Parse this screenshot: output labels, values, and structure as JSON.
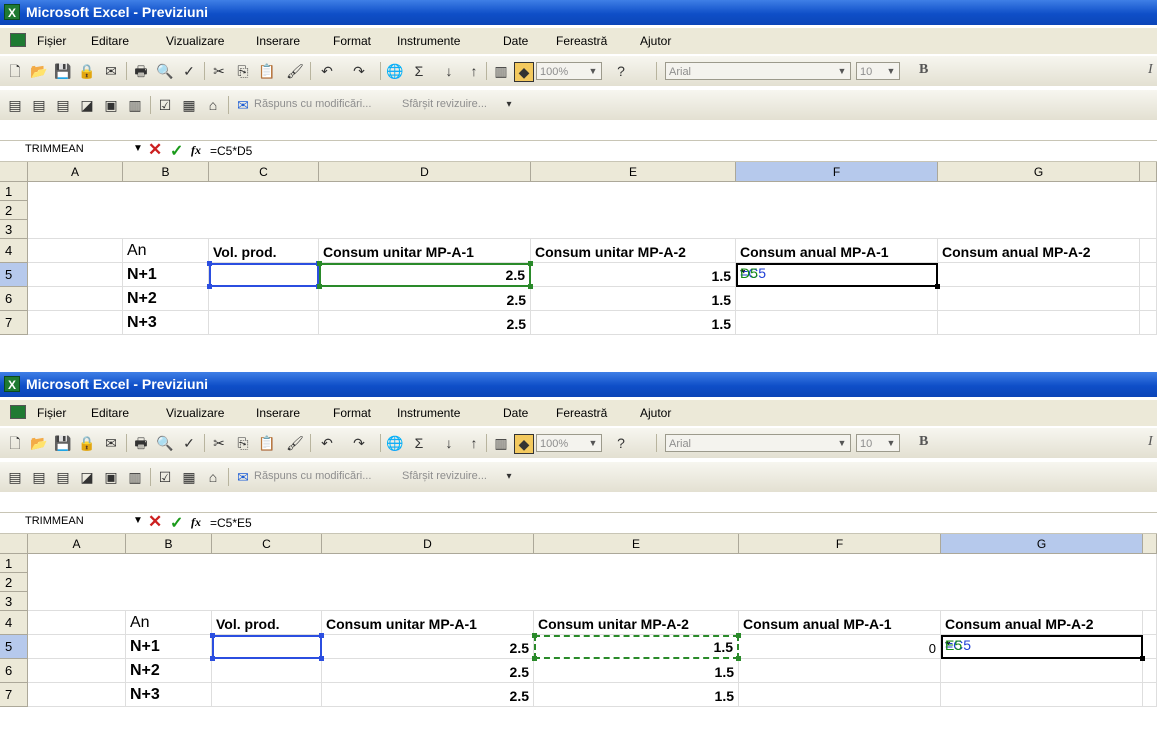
{
  "windows": [
    {
      "title": "Microsoft Excel - Previziuni",
      "menu": [
        "Fișier",
        "Editare",
        "Vizualizare",
        "Inserare",
        "Format",
        "Instrumente",
        "Date",
        "Fereastră",
        "Ajutor"
      ],
      "toolbar": {
        "zoom": "100%",
        "font": "Arial",
        "size": "10",
        "bold": "B",
        "italic": "I",
        "review_reply": "Răspuns cu modificări...",
        "review_end": "Sfârșit revizuire..."
      },
      "formula_bar": {
        "name_box": "TRIMMEAN",
        "formula": "=C5*D5"
      },
      "columns": [
        "A",
        "B",
        "C",
        "D",
        "E",
        "F",
        "G"
      ],
      "rows": [
        "1",
        "2",
        "3",
        "4",
        "5",
        "6",
        "7"
      ],
      "header_row": {
        "b": "An",
        "c": "Vol. prod.",
        "d": "Consum unitar MP-A-1",
        "e": "Consum unitar MP-A-2",
        "f": "Consum anual MP-A-1",
        "g": "Consum anual MP-A-2"
      },
      "data": [
        {
          "b": "N+1",
          "d": "2.5",
          "e": "1.5"
        },
        {
          "b": "N+2",
          "d": "2.5",
          "e": "1.5"
        },
        {
          "b": "N+3",
          "d": "2.5",
          "e": "1.5"
        }
      ],
      "edit_cell": {
        "part1": "=C5",
        "op": "*",
        "part2": "D5"
      }
    },
    {
      "title": "Microsoft Excel - Previziuni",
      "menu": [
        "Fișier",
        "Editare",
        "Vizualizare",
        "Inserare",
        "Format",
        "Instrumente",
        "Date",
        "Fereastră",
        "Ajutor"
      ],
      "toolbar": {
        "zoom": "100%",
        "font": "Arial",
        "size": "10",
        "bold": "B",
        "italic": "I",
        "review_reply": "Răspuns cu modificări...",
        "review_end": "Sfârșit revizuire..."
      },
      "formula_bar": {
        "name_box": "TRIMMEAN",
        "formula": "=C5*E5"
      },
      "columns": [
        "A",
        "B",
        "C",
        "D",
        "E",
        "F",
        "G"
      ],
      "rows": [
        "1",
        "2",
        "3",
        "4",
        "5",
        "6",
        "7"
      ],
      "header_row": {
        "b": "An",
        "c": "Vol. prod.",
        "d": "Consum unitar MP-A-1",
        "e": "Consum unitar MP-A-2",
        "f": "Consum anual MP-A-1",
        "g": "Consum anual MP-A-2"
      },
      "data": [
        {
          "b": "N+1",
          "d": "2.5",
          "e": "1.5",
          "f": "0"
        },
        {
          "b": "N+2",
          "d": "2.5",
          "e": "1.5"
        },
        {
          "b": "N+3",
          "d": "2.5",
          "e": "1.5"
        }
      ],
      "edit_cell": {
        "part1": "=C5",
        "op": "*",
        "part2": "E5"
      }
    }
  ]
}
